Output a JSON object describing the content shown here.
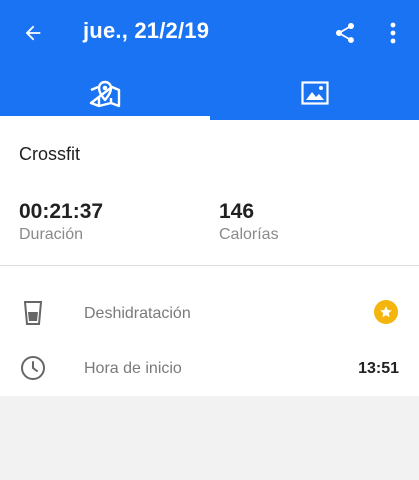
{
  "header": {
    "title": "jue., 21/2/19",
    "back_icon": "arrow-back-icon",
    "share_icon": "share-icon",
    "more_icon": "more-vert-icon",
    "bar_color": "#1a73f2"
  },
  "tabs": [
    {
      "icon": "map-pin-icon",
      "selected": true
    },
    {
      "icon": "image-icon",
      "selected": false
    }
  ],
  "activity": {
    "name": "Crossfit",
    "stats": [
      {
        "value": "00:21:37",
        "label": "Duración"
      },
      {
        "value": "146",
        "label": "Calorías"
      }
    ]
  },
  "details": [
    {
      "icon": "glass-icon",
      "label": "Deshidratación",
      "trailing_icon": "star-icon",
      "trailing_color": "#f5b50f"
    },
    {
      "icon": "clock-icon",
      "label": "Hora de inicio",
      "value": "13:51"
    }
  ]
}
